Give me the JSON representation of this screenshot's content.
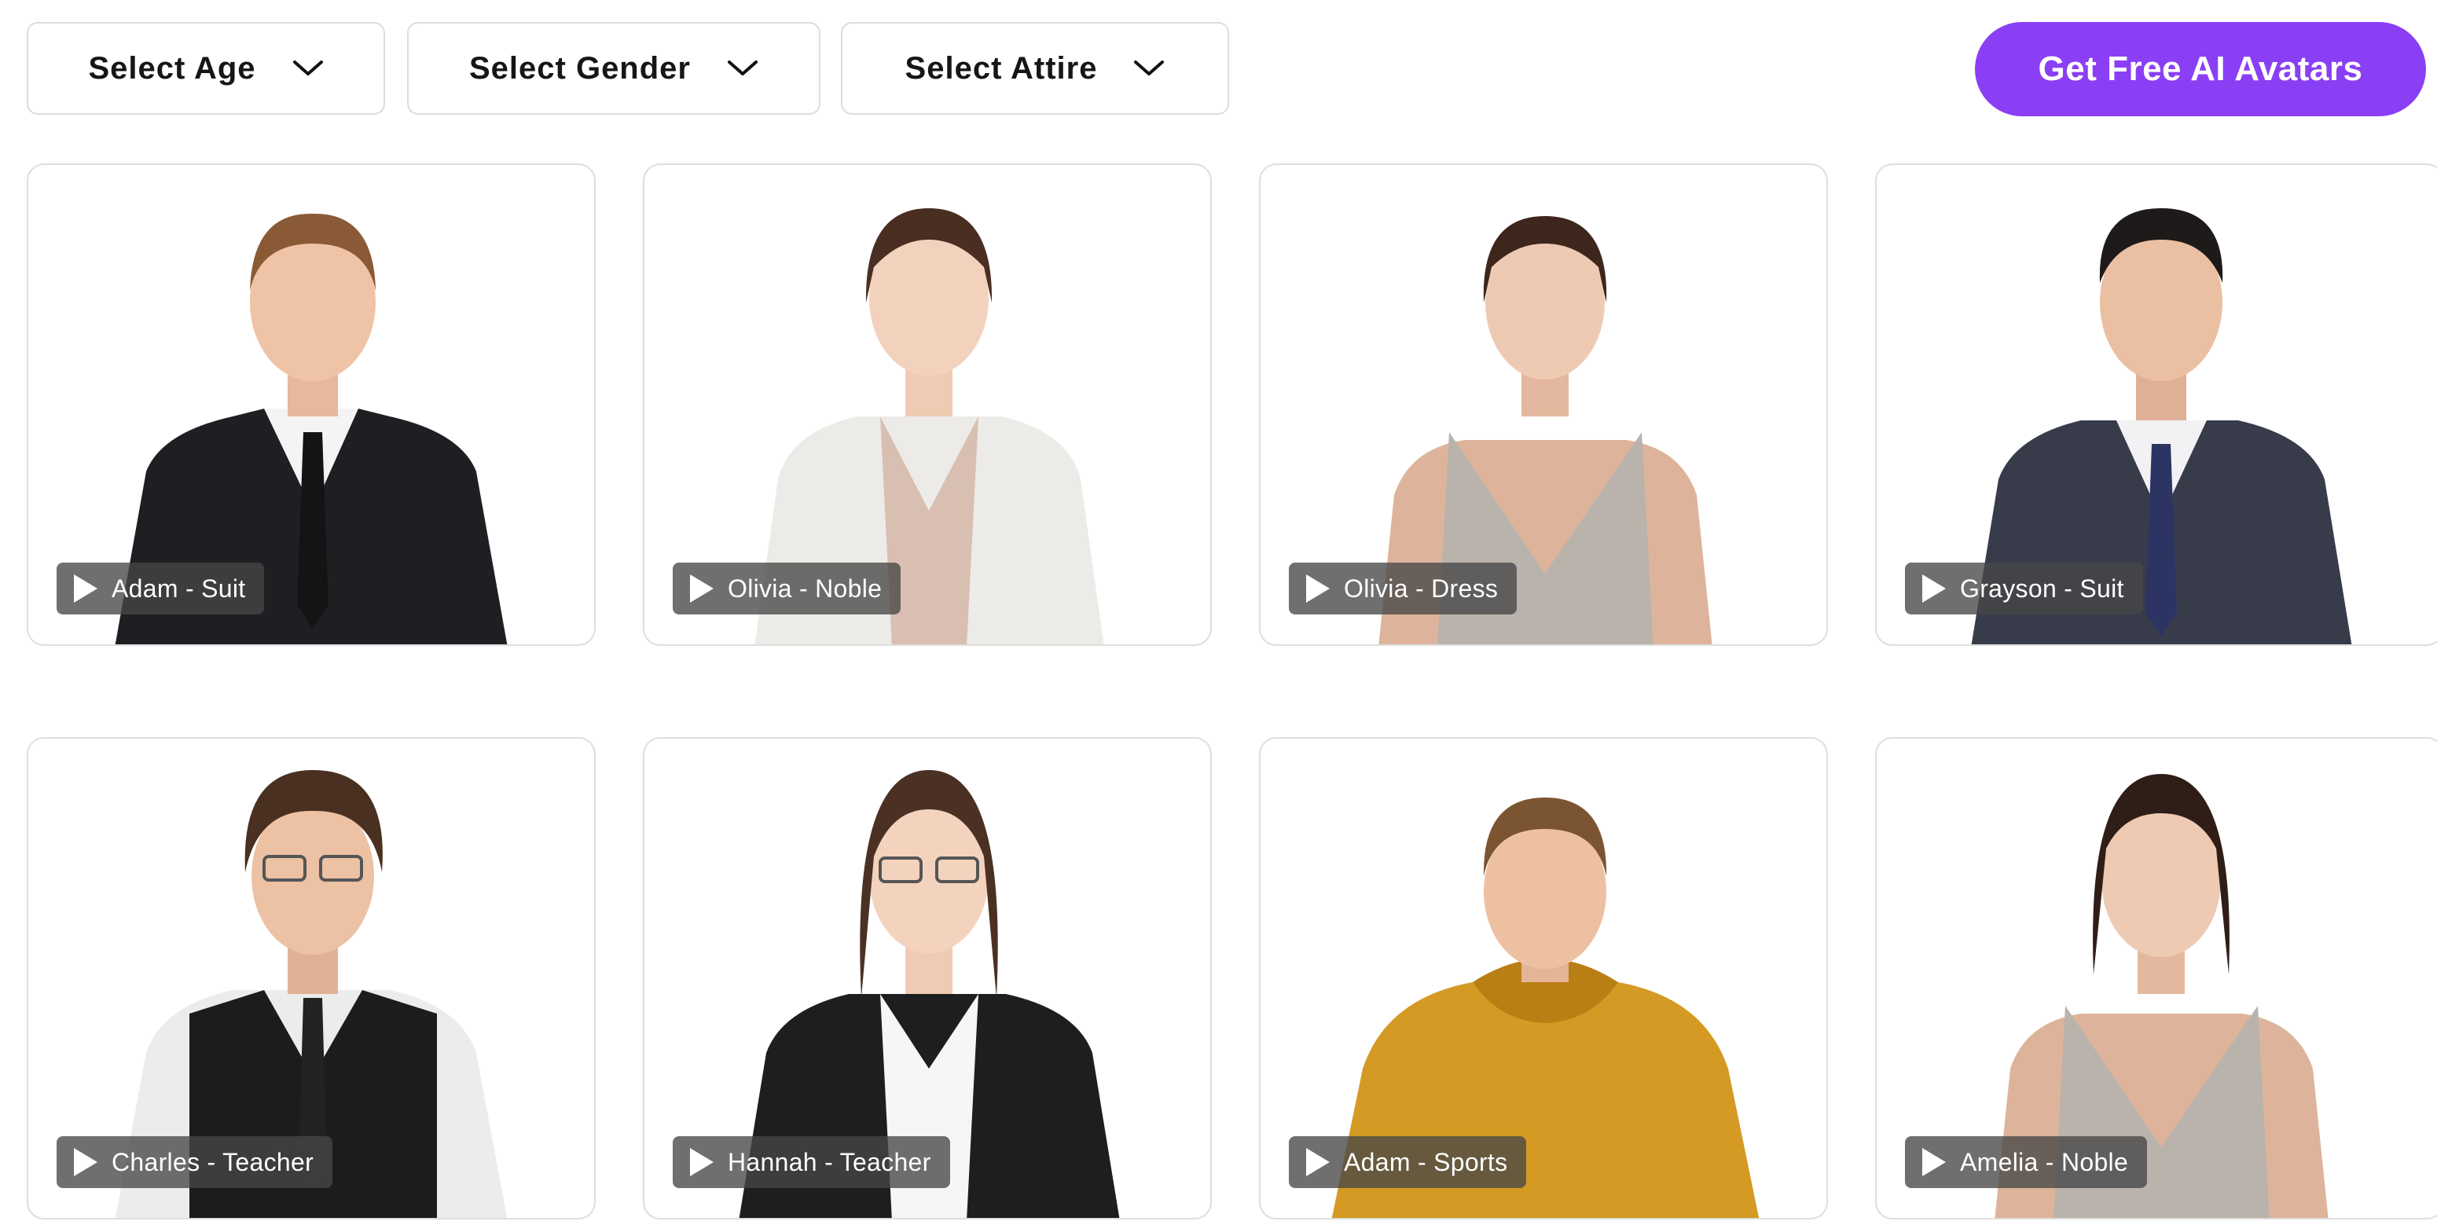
{
  "filters": {
    "age_label": "Select Age",
    "gender_label": "Select Gender",
    "attire_label": "Select Attire"
  },
  "cta": {
    "label": "Get Free AI Avatars",
    "color": "#8a3ff5"
  },
  "avatars": [
    {
      "label": "Adam - Suit",
      "outfit": "black-suit"
    },
    {
      "label": "Olivia - Noble",
      "outfit": "white-blazer"
    },
    {
      "label": "Olivia - Dress",
      "outfit": "grey-halter-dress"
    },
    {
      "label": "Grayson - Suit",
      "outfit": "navy-suit"
    },
    {
      "label": "Charles - Teacher",
      "outfit": "black-vest"
    },
    {
      "label": "Hannah - Teacher",
      "outfit": "black-blazer"
    },
    {
      "label": "Adam - Sports",
      "outfit": "mustard-hoodie"
    },
    {
      "label": "Amelia - Noble",
      "outfit": "grey-halter-dress"
    }
  ]
}
